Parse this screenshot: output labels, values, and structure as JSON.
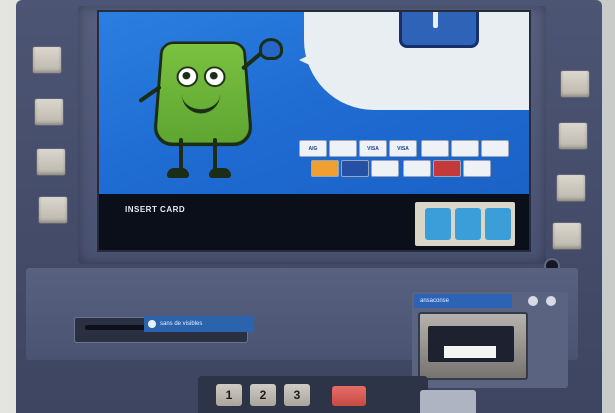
{
  "screen": {
    "bar_text": "INSERT CARD"
  },
  "card_logos": [
    "AIG",
    "",
    "VISA",
    "VISA",
    "",
    "",
    "",
    "",
    "",
    "",
    "",
    "",
    ""
  ],
  "slot_sticker": {
    "text": "sans de visibles"
  },
  "right_panel": {
    "label": "ansaconse"
  },
  "keypad": {
    "keys": [
      "1",
      "2",
      "3"
    ]
  },
  "colors": {
    "screen_blue": "#1e6bd2",
    "mascot_green": "#5fa632",
    "body": "#4a5371"
  }
}
